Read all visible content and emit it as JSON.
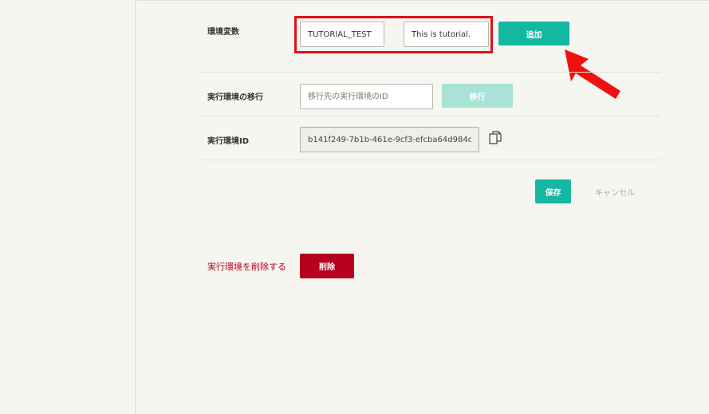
{
  "env_vars": {
    "label": "環境変数",
    "key_value": "TUTORIAL_TEST",
    "val_value": "This is tutorial.",
    "add_button": "追加"
  },
  "migrate": {
    "label": "実行環境の移行",
    "placeholder": "移行先の実行環境のID",
    "button": "移行"
  },
  "env_id": {
    "label": "実行環境ID",
    "value": "b141f249-7b1b-461e-9cf3-efcba64d984c"
  },
  "actions": {
    "save": "保存",
    "cancel": "キャンセル"
  },
  "danger": {
    "label": "実行環境を削除する",
    "delete_button": "削除"
  },
  "colors": {
    "accent": "#14b8a0",
    "danger": "#b5001f",
    "highlight": "#e0101a"
  }
}
